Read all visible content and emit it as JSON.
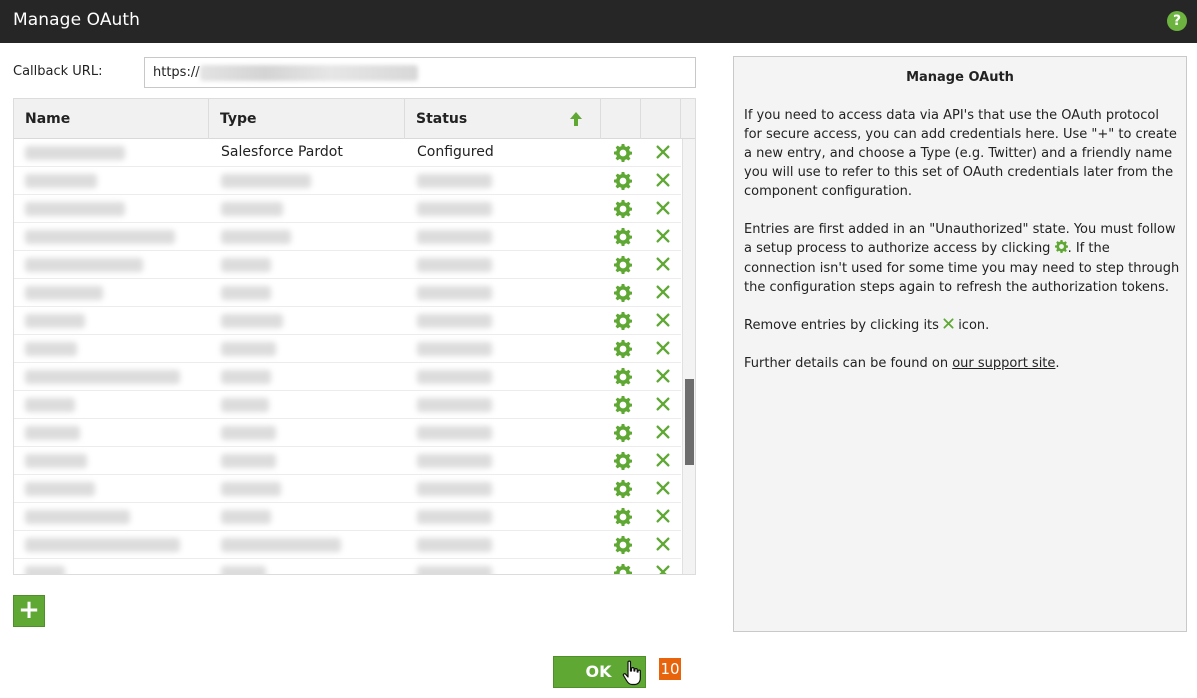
{
  "window": {
    "title": "Manage OAuth",
    "help_icon": "question-circle-icon",
    "help_glyph": "?"
  },
  "callback": {
    "label": "Callback URL:",
    "value": "https://"
  },
  "grid": {
    "columns": [
      "Name",
      "Type",
      "Status"
    ],
    "sort_icon": "arrow-up-icon",
    "rows": [
      {
        "name": "",
        "type": "Salesforce Pardot",
        "status": "Configured"
      },
      {
        "name": "",
        "type": "",
        "status": ""
      },
      {
        "name": "",
        "type": "",
        "status": ""
      },
      {
        "name": "",
        "type": "",
        "status": ""
      },
      {
        "name": "",
        "type": "",
        "status": ""
      },
      {
        "name": "",
        "type": "",
        "status": ""
      },
      {
        "name": "",
        "type": "",
        "status": ""
      },
      {
        "name": "",
        "type": "",
        "status": ""
      },
      {
        "name": "",
        "type": "",
        "status": ""
      },
      {
        "name": "",
        "type": "",
        "status": ""
      },
      {
        "name": "",
        "type": "",
        "status": ""
      },
      {
        "name": "",
        "type": "",
        "status": ""
      },
      {
        "name": "",
        "type": "",
        "status": ""
      },
      {
        "name": "",
        "type": "",
        "status": ""
      },
      {
        "name": "",
        "type": "",
        "status": ""
      },
      {
        "name": "",
        "type": "",
        "status": ""
      }
    ],
    "row_icons": {
      "configure": "gear-icon",
      "remove": "close-icon"
    }
  },
  "add_button": {
    "label": "+"
  },
  "help_panel": {
    "title": "Manage OAuth",
    "p1": "If you need to access data via API's that use the OAuth protocol for secure access, you can add credentials here. Use \"+\" to create a new entry, and choose a Type (e.g. Twitter) and a friendly name you will use to refer to this set of OAuth credentials later from the component configuration.",
    "p2_a": "Entries are first added in an \"Unauthorized\" state. You must follow a setup process to authorize access by clicking ",
    "p2_b": ". If the connection isn't used for some time you may need to step through the configuration steps again to refresh the authorization tokens.",
    "p3_a": "Remove entries by clicking its ",
    "p3_b": " icon.",
    "p4_a": "Further details can be found on ",
    "p4_link": "our support site",
    "p4_b": "."
  },
  "ok_button": {
    "label": "OK"
  },
  "step_badge": "10",
  "colors": {
    "accent": "#5fa834",
    "titlebar": "#262626",
    "badge": "#e8640c"
  }
}
